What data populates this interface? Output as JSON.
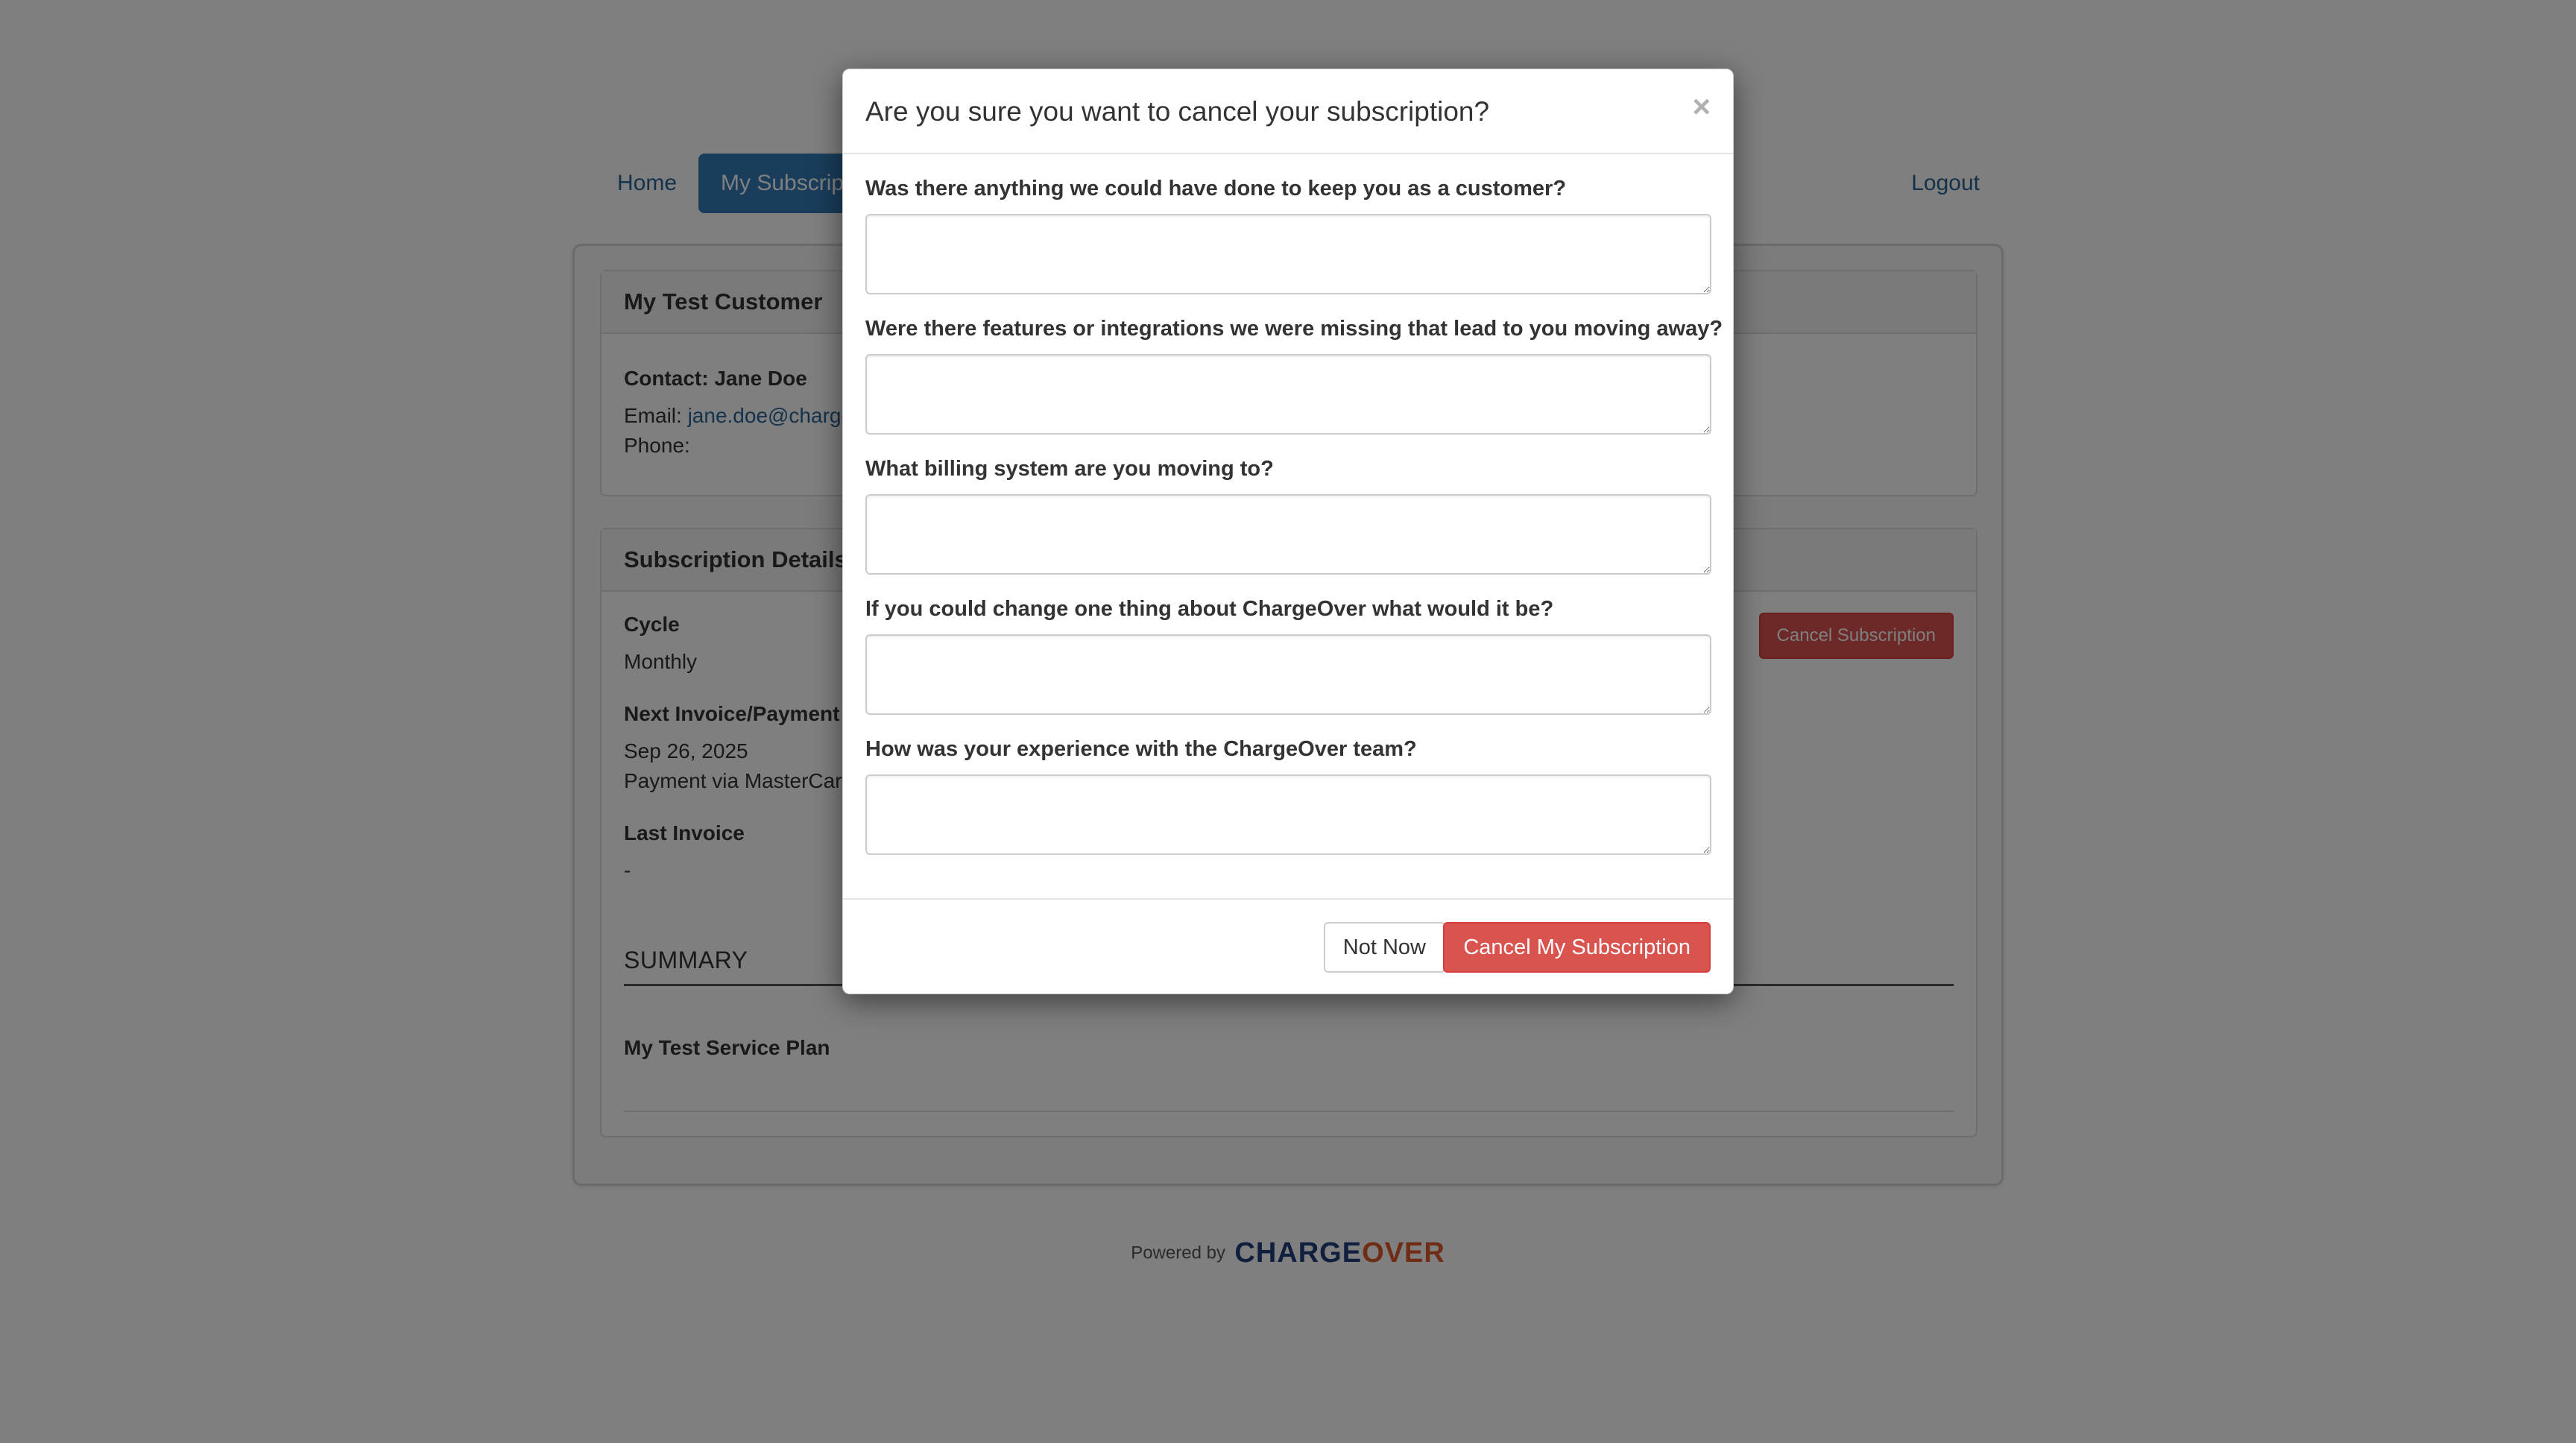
{
  "nav": {
    "home": "Home",
    "my_subscriptions": "My Subscriptions",
    "logout": "Logout"
  },
  "customer": {
    "name": "My Test Customer",
    "contact": "Contact: Jane Doe",
    "email_label": "Email:",
    "email_value": "jane.doe@chargeover.test",
    "phone_label": "Phone:"
  },
  "subscription": {
    "heading": "Subscription Details",
    "cancel_button": "Cancel Subscription",
    "cycle_label": "Cycle",
    "cycle_value": "Monthly",
    "next_label": "Next Invoice/Payment",
    "next_date": "Sep 26, 2025",
    "next_method": "Payment via MasterCard",
    "last_label": "Last Invoice",
    "last_value": "-",
    "summary_title": "SUMMARY",
    "plan_name": "My Test Service Plan"
  },
  "footer": {
    "powered_by": "Powered by",
    "logo_charge": "CHARGE",
    "logo_o": "O",
    "logo_ver": "VER"
  },
  "modal": {
    "title": "Are you sure you want to cancel your subscription?",
    "close_glyph": "×",
    "questions": [
      {
        "label": "Was there anything we could have done to keep you as a customer?",
        "value": ""
      },
      {
        "label": "Were there features or integrations we were missing that lead to you moving away?",
        "value": ""
      },
      {
        "label": "What billing system are you moving to?",
        "value": ""
      },
      {
        "label": "If you could change one thing about ChargeOver what would it be?",
        "value": ""
      },
      {
        "label": "How was your experience with the ChargeOver team?",
        "value": ""
      }
    ],
    "not_now": "Not Now",
    "confirm": "Cancel My Subscription"
  },
  "colors": {
    "primary": "#337ab7",
    "danger": "#d9534f",
    "logo_blue": "#1f3f7a",
    "logo_orange": "#e05a2b"
  }
}
